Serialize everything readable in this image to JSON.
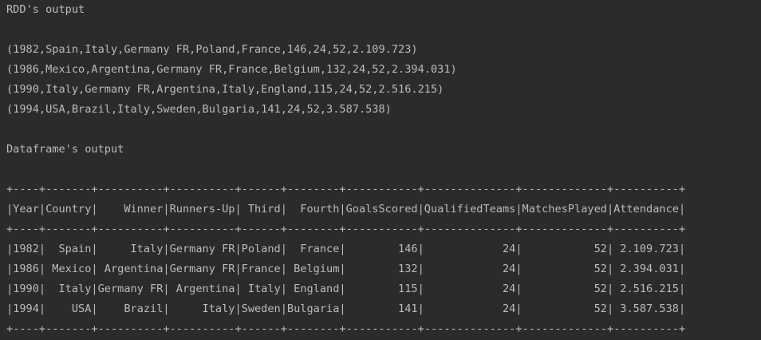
{
  "colors": {
    "background": "#2b2b2b",
    "text": "#bbbbbb"
  },
  "console": {
    "rdd_header": "RDD's output",
    "rdd_rows": [
      "(1982,Spain,Italy,Germany FR,Poland,France,146,24,52,2.109.723)",
      "(1986,Mexico,Argentina,Germany FR,France,Belgium,132,24,52,2.394.031)",
      "(1990,Italy,Germany FR,Argentina,Italy,England,115,24,52,2.516.215)",
      "(1994,USA,Brazil,Italy,Sweden,Bulgaria,141,24,52,3.587.538)"
    ],
    "df_header": "Dataframe's output",
    "df_table": {
      "border_top": "+----+-------+----------+----------+------+--------+-----------+--------------+-------------+----------+",
      "header_row": "|Year|Country|    Winner|Runners-Up| Third|  Fourth|GoalsScored|QualifiedTeams|MatchesPlayed|Attendance|",
      "border_mid": "+----+-------+----------+----------+------+--------+-----------+--------------+-------------+----------+",
      "rows": [
        "|1982|  Spain|     Italy|Germany FR|Poland|  France|        146|            24|           52| 2.109.723|",
        "|1986| Mexico| Argentina|Germany FR|France| Belgium|        132|            24|           52| 2.394.031|",
        "|1990|  Italy|Germany FR| Argentina| Italy| England|        115|            24|           52| 2.516.215|",
        "|1994|    USA|    Brazil|     Italy|Sweden|Bulgaria|        141|            24|           52| 3.587.538|"
      ],
      "border_bottom": "+----+-------+----------+----------+------+--------+-----------+--------------+-------------+----------+"
    }
  }
}
